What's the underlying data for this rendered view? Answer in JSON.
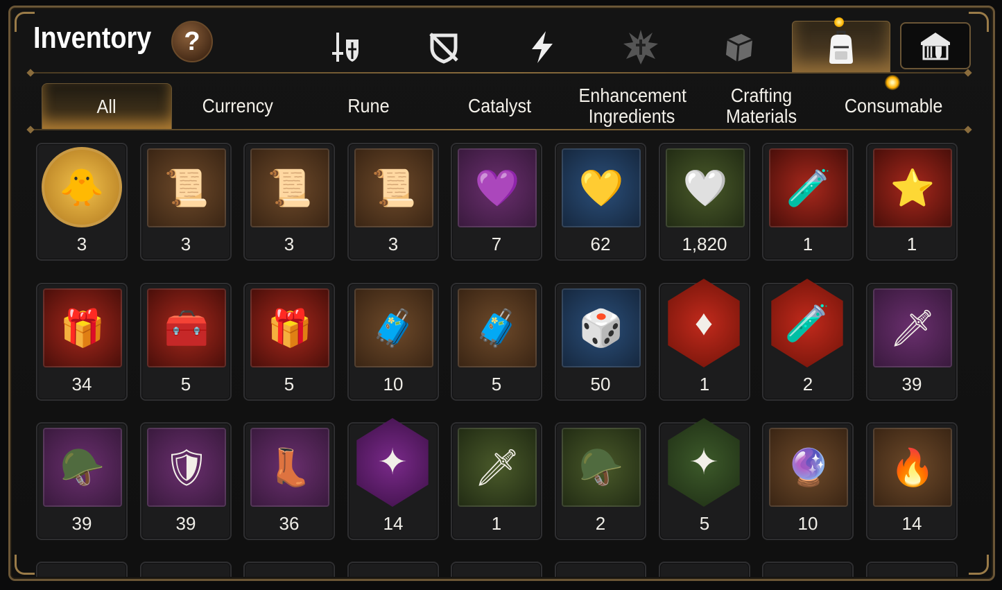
{
  "header": {
    "title": "Inventory",
    "help_label": "?"
  },
  "category_tabs": [
    {
      "icon": "sword-shield-icon",
      "active": false
    },
    {
      "icon": "crossed-shield-icon",
      "active": false
    },
    {
      "icon": "lightning-icon",
      "active": false
    },
    {
      "icon": "splash-emblem-icon",
      "active": false
    },
    {
      "icon": "cube-icon",
      "active": false
    },
    {
      "icon": "backpack-icon",
      "active": true
    }
  ],
  "guild_button_icon": "guild-hall-icon",
  "sub_tabs": [
    {
      "label": "All",
      "active": true
    },
    {
      "label": "Currency",
      "active": false
    },
    {
      "label": "Rune",
      "active": false
    },
    {
      "label": "Catalyst",
      "active": false
    },
    {
      "label": "Enhancement Ingredients",
      "active": false
    },
    {
      "label": "Crafting Materials",
      "active": false
    },
    {
      "label": "Consumable",
      "active": false
    }
  ],
  "items": [
    {
      "icon": "mascot-portrait-icon",
      "glyph": "🐥",
      "bg": "gold",
      "shape": "circle",
      "qty": "3"
    },
    {
      "icon": "upgrade-scroll-icon",
      "glyph": "📜",
      "bg": "brown",
      "shape": "square",
      "qty": "3"
    },
    {
      "icon": "rainbow-upgrade-scroll-icon",
      "glyph": "📜",
      "bg": "brown",
      "shape": "square",
      "qty": "3"
    },
    {
      "icon": "upgrade-scroll-icon",
      "glyph": "📜",
      "bg": "brown",
      "shape": "square",
      "qty": "3"
    },
    {
      "icon": "purple-crystal-icon",
      "glyph": "💜",
      "bg": "purple",
      "shape": "square",
      "qty": "7"
    },
    {
      "icon": "gold-crystal-icon",
      "glyph": "💛",
      "bg": "blue",
      "shape": "square",
      "qty": "62"
    },
    {
      "icon": "silver-crystal-icon",
      "glyph": "🤍",
      "bg": "green",
      "shape": "square",
      "qty": "1,820"
    },
    {
      "icon": "red-potion-icon",
      "glyph": "🧪",
      "bg": "red",
      "shape": "square",
      "qty": "1"
    },
    {
      "icon": "star-potion-icon",
      "glyph": "⭐",
      "bg": "red",
      "shape": "square",
      "qty": "1"
    },
    {
      "icon": "silver-chest-icon",
      "glyph": "🎁",
      "bg": "red",
      "shape": "square",
      "qty": "34"
    },
    {
      "icon": "blue-chest-icon",
      "glyph": "🧰",
      "bg": "red",
      "shape": "square",
      "qty": "5"
    },
    {
      "icon": "red-chest-icon",
      "glyph": "🎁",
      "bg": "red",
      "shape": "square",
      "qty": "5"
    },
    {
      "icon": "golden-chest-icon",
      "glyph": "🧳",
      "bg": "brown",
      "shape": "square",
      "qty": "10"
    },
    {
      "icon": "golden-chest-icon",
      "glyph": "🧳",
      "bg": "brown",
      "shape": "square",
      "qty": "5"
    },
    {
      "icon": "dark-cube-icon",
      "glyph": "🎲",
      "bg": "blue",
      "shape": "square",
      "qty": "50"
    },
    {
      "icon": "red-rune-gem-icon",
      "glyph": "♦",
      "bg": "hexred",
      "shape": "hex",
      "qty": "1"
    },
    {
      "icon": "pink-potion-icon",
      "glyph": "🧪",
      "bg": "hexred",
      "shape": "hex",
      "qty": "2"
    },
    {
      "icon": "sword-rune-stone-icon",
      "glyph": "🗡",
      "bg": "purple",
      "shape": "square",
      "qty": "39"
    },
    {
      "icon": "helmet-rune-stone-icon",
      "glyph": "🪖",
      "bg": "purple",
      "shape": "square",
      "qty": "39"
    },
    {
      "icon": "armor-rune-stone-icon",
      "glyph": "🛡",
      "bg": "purple",
      "shape": "square",
      "qty": "39"
    },
    {
      "icon": "boot-rune-stone-icon",
      "glyph": "👢",
      "bg": "purple",
      "shape": "square",
      "qty": "36"
    },
    {
      "icon": "star-rune-stone-icon",
      "glyph": "✦",
      "bg": "hexpur",
      "shape": "hex",
      "qty": "14"
    },
    {
      "icon": "sword-rune-tablet-icon",
      "glyph": "🗡",
      "bg": "green",
      "shape": "square",
      "qty": "1"
    },
    {
      "icon": "helmet-rune-tablet-icon",
      "glyph": "🪖",
      "bg": "green",
      "shape": "square",
      "qty": "2"
    },
    {
      "icon": "star-rune-tablet-icon",
      "glyph": "✦",
      "bg": "hexgrn",
      "shape": "hex",
      "qty": "5"
    },
    {
      "icon": "pink-orb-icon",
      "glyph": "🔮",
      "bg": "brown",
      "shape": "square",
      "qty": "10"
    },
    {
      "icon": "fire-orb-icon",
      "glyph": "🔥",
      "bg": "brown",
      "shape": "square",
      "qty": "14"
    }
  ],
  "colors": {
    "frame": "#6b5636",
    "accent_gold": "#ffb400",
    "background": "#101010"
  }
}
